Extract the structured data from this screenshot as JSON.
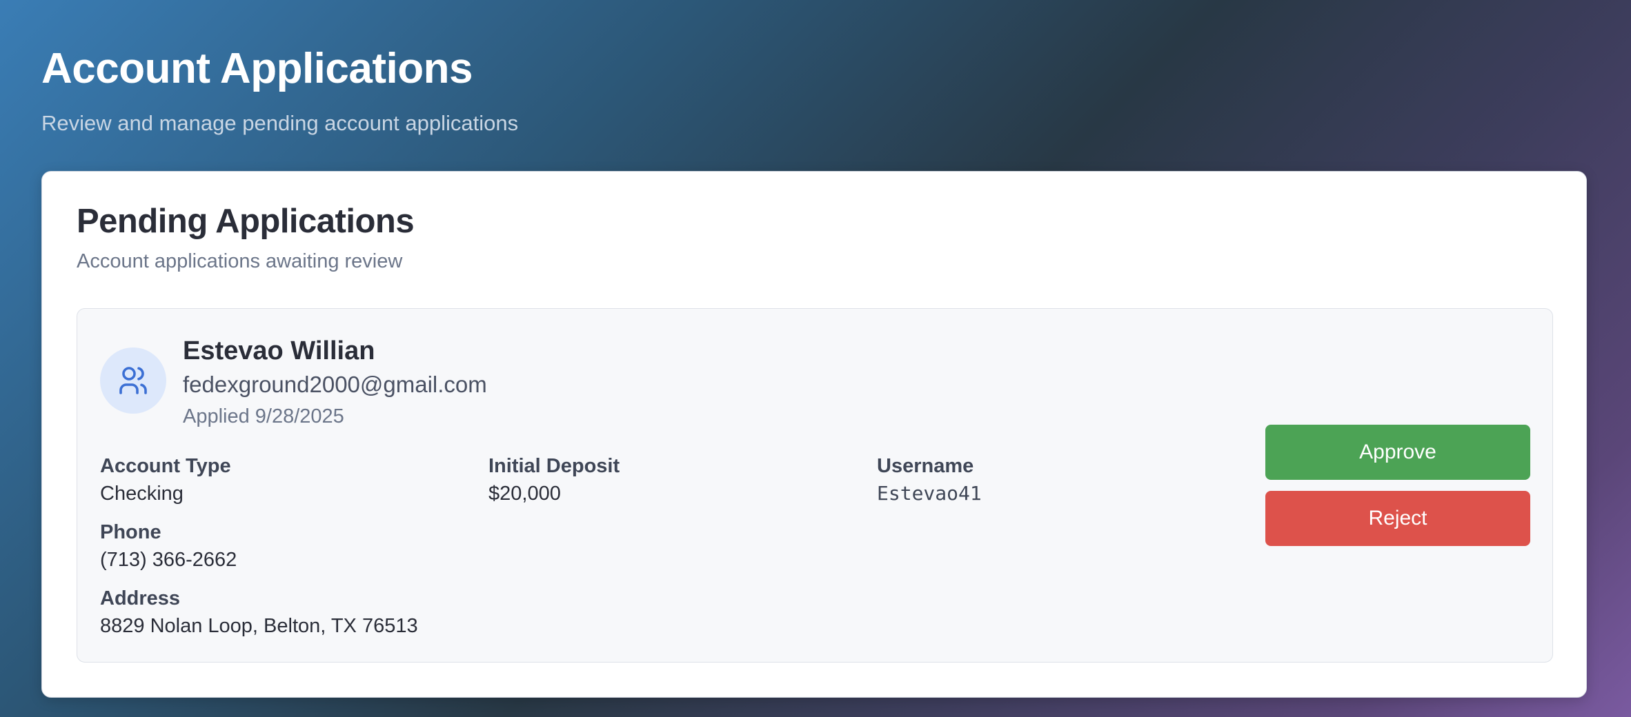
{
  "header": {
    "title": "Account Applications",
    "subtitle": "Review and manage pending account applications"
  },
  "panel": {
    "title": "Pending Applications",
    "subtitle": "Account applications awaiting review"
  },
  "application": {
    "avatar_icon": "users-icon",
    "name": "Estevao Willian",
    "email": "fedexground2000@gmail.com",
    "applied": "Applied 9/28/2025",
    "fields": {
      "account_type": {
        "label": "Account Type",
        "value": "Checking"
      },
      "initial_deposit": {
        "label": "Initial Deposit",
        "value": "$20,000"
      },
      "username": {
        "label": "Username",
        "value": "Estevao41"
      },
      "phone": {
        "label": "Phone",
        "value": "(713) 366-2662"
      },
      "address": {
        "label": "Address",
        "value": "8829 Nolan Loop, Belton, TX 76513"
      }
    },
    "actions": {
      "approve_label": "Approve",
      "reject_label": "Reject"
    }
  },
  "colors": {
    "approve": "#4ca355",
    "reject": "#dd524b",
    "avatar_bg": "#dde8fb",
    "avatar_icon": "#3b6fd4"
  }
}
